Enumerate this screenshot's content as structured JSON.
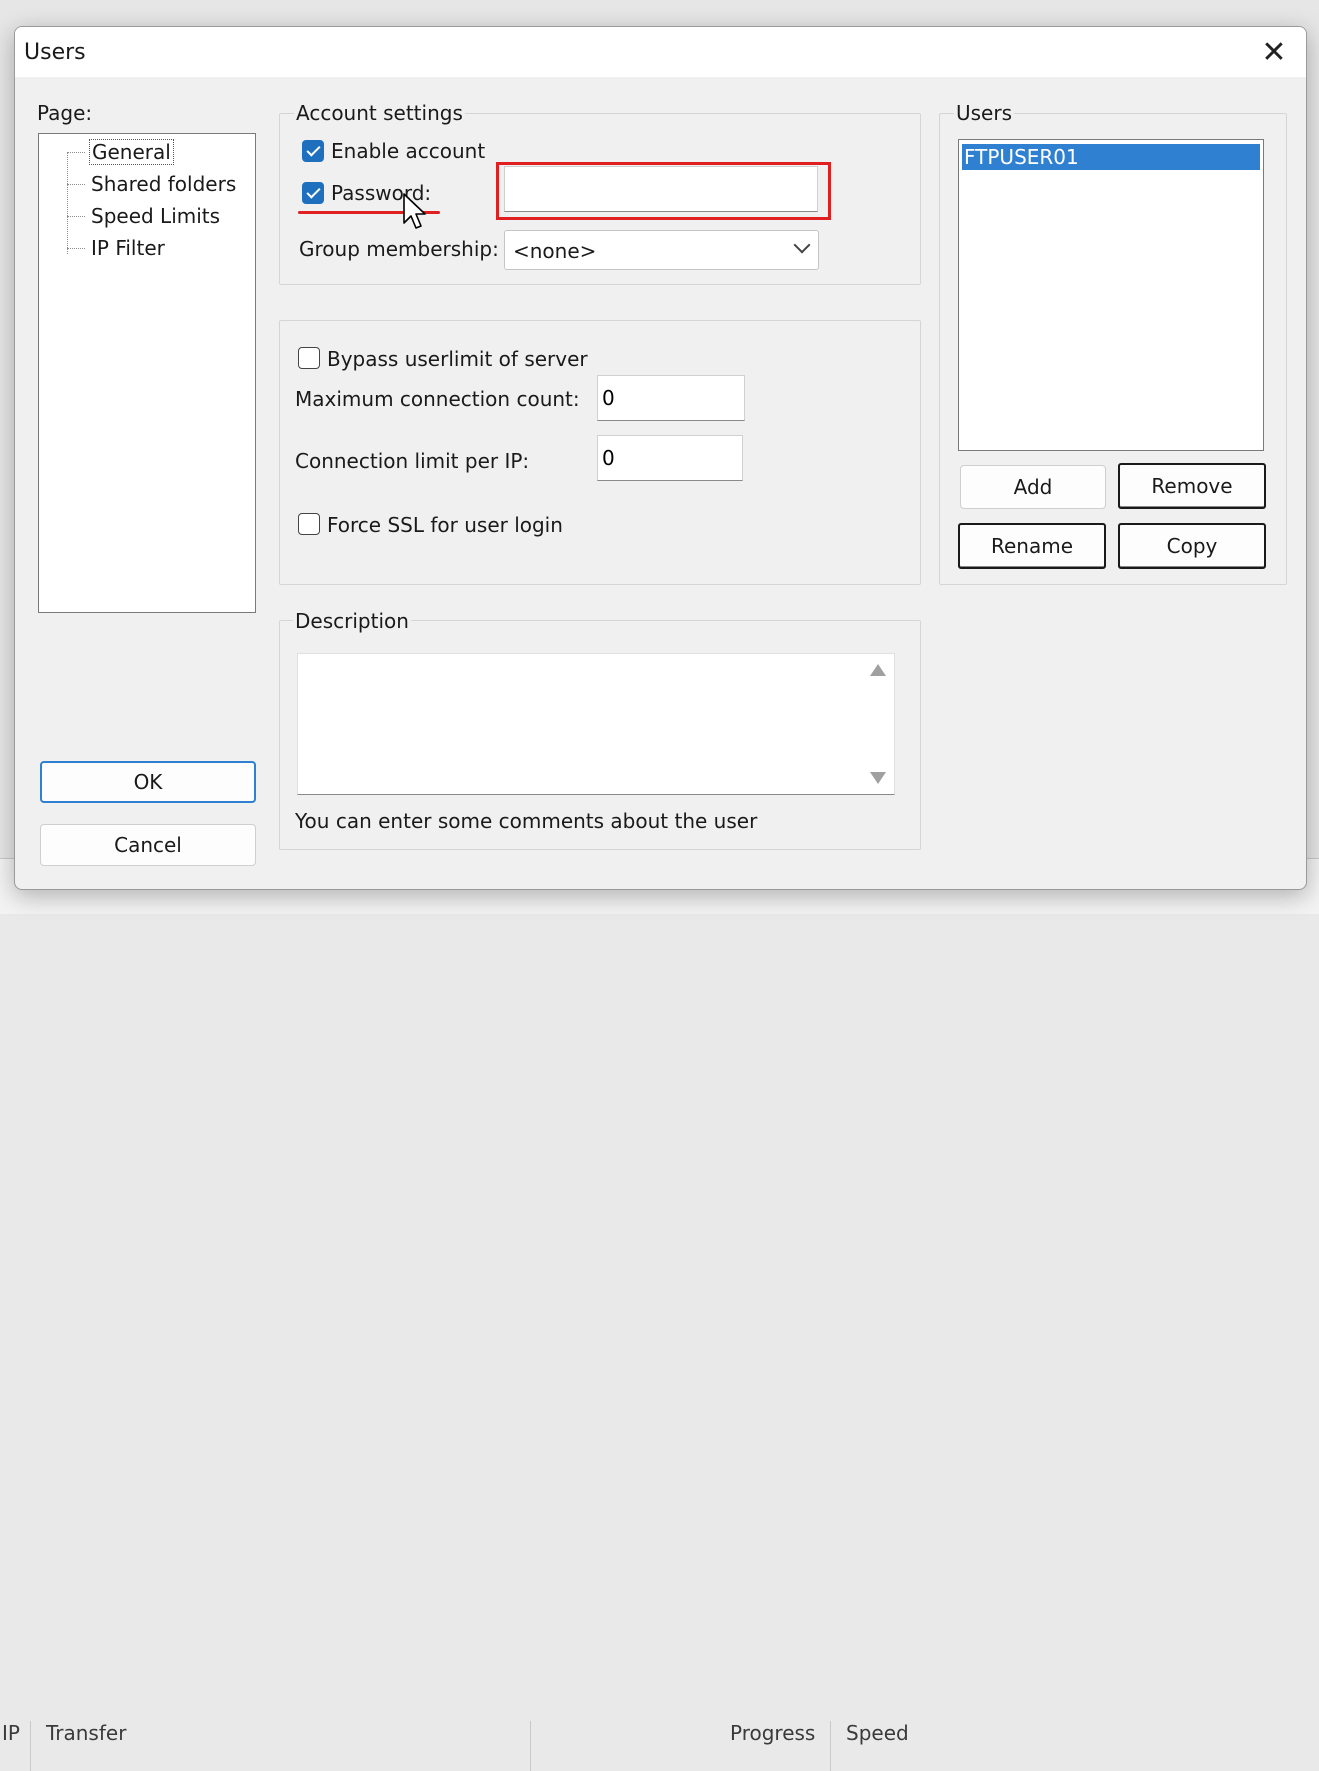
{
  "background": {
    "status_columns": [
      "IP",
      "Transfer",
      "Progress",
      "Speed"
    ]
  },
  "dialog": {
    "title": "Users",
    "close_glyph": "✕"
  },
  "page_panel": {
    "label": "Page:",
    "items": [
      {
        "label": "General",
        "selected": true
      },
      {
        "label": "Shared folders",
        "selected": false
      },
      {
        "label": "Speed Limits",
        "selected": false
      },
      {
        "label": "IP Filter",
        "selected": false
      }
    ]
  },
  "account_settings": {
    "legend": "Account settings",
    "enable_account": {
      "label": "Enable account",
      "checked": true
    },
    "password": {
      "label": "Password:",
      "checked": true,
      "value": ""
    },
    "group_membership": {
      "label": "Group membership:",
      "value": "<none>"
    }
  },
  "limits": {
    "bypass_userlimit": {
      "label": "Bypass userlimit of server",
      "checked": false
    },
    "max_connection_count": {
      "label": "Maximum connection count:",
      "value": "0"
    },
    "connection_limit_per_ip": {
      "label": "Connection limit per IP:",
      "value": "0"
    },
    "force_ssl": {
      "label": "Force SSL for user login",
      "checked": false
    }
  },
  "description": {
    "legend": "Description",
    "value": "",
    "hint": "You can enter some comments about the user"
  },
  "users_panel": {
    "legend": "Users",
    "items": [
      "FTPUSER01"
    ],
    "buttons": {
      "add": "Add",
      "remove": "Remove",
      "rename": "Rename",
      "copy": "Copy"
    }
  },
  "footer_buttons": {
    "ok": "OK",
    "cancel": "Cancel"
  },
  "colors": {
    "accent": "#1f6fbf",
    "selection": "#2f80d1",
    "annotation": "#e02020"
  }
}
